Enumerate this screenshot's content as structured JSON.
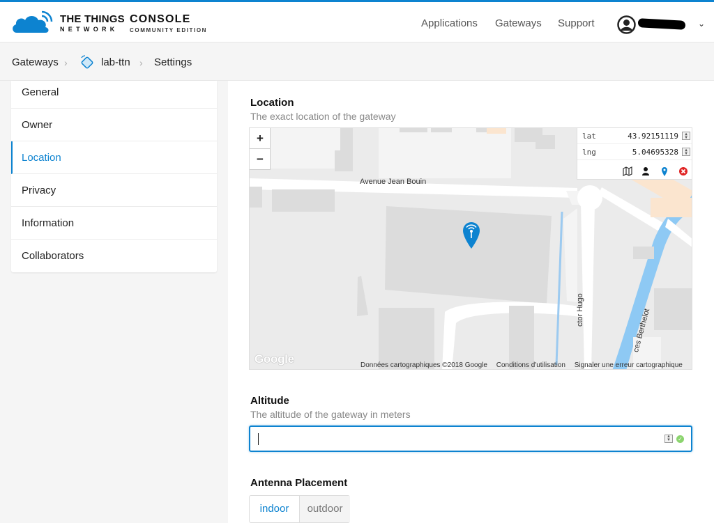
{
  "header": {
    "brand_line1": "THE THINGS",
    "brand_line2": "NETWORK",
    "console_title": "CONSOLE",
    "console_sub": "COMMUNITY EDITION",
    "nav": [
      "Applications",
      "Gateways",
      "Support"
    ],
    "caret": "⌄"
  },
  "breadcrumb": {
    "items": [
      "Gateways",
      "lab-ttn",
      "Settings"
    ],
    "separator": "›"
  },
  "sidebar": {
    "items": [
      "General",
      "Owner",
      "Location",
      "Privacy",
      "Information",
      "Collaborators"
    ],
    "active": "Location"
  },
  "location": {
    "title": "Location",
    "description": "The exact location of the gateway",
    "zoom_in": "+",
    "zoom_out": "−",
    "lat_label": "lat",
    "lat_value": "43.92151119",
    "lng_label": "lng",
    "lng_value": "5.04695328",
    "street_1": "Avenue Jean Bouin",
    "street_2": "ctor Hugo",
    "street_3": "ces Berthelot",
    "google": "Google",
    "attribution": [
      "Données cartographiques ©2018 Google",
      "Conditions d'utilisation",
      "Signaler une erreur cartographique"
    ]
  },
  "altitude": {
    "title": "Altitude",
    "description": "The altitude of the gateway in meters",
    "value": ""
  },
  "antenna": {
    "title": "Antenna Placement",
    "options": [
      "indoor",
      "outdoor"
    ],
    "selected": "indoor"
  },
  "colors": {
    "accent": "#0d83d0",
    "ok": "#8bd46e",
    "error": "#e02424"
  }
}
